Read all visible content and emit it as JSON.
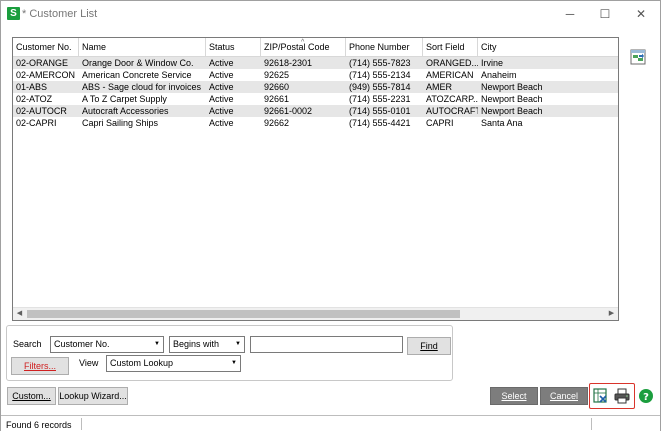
{
  "window": {
    "app_icon_letter": "S",
    "title": "* Customer List",
    "minimize_glyph": "─",
    "maximize_glyph": "☐",
    "close_glyph": "✕"
  },
  "grid": {
    "columns": [
      "Customer No.",
      "Name",
      "Status",
      "ZIP/Postal Code",
      "Phone Number",
      "Sort Field",
      "City"
    ],
    "sort_indicator": "^",
    "rows": [
      [
        "02-ORANGE",
        "Orange Door & Window Co.",
        "Active",
        "92618-2301",
        "(714) 555-7823",
        "ORANGED...",
        "Irvine"
      ],
      [
        "02-AMERCON",
        "American Concrete Service",
        "Active",
        "92625",
        "(714) 555-2134",
        "AMERICAN",
        "Anaheim"
      ],
      [
        "01-ABS",
        "ABS - Sage cloud for invoices",
        "Active",
        "92660",
        "(949) 555-7814",
        "AMER",
        "Newport Beach"
      ],
      [
        "02-ATOZ",
        "A To Z Carpet Supply",
        "Active",
        "92661",
        "(714) 555-2231",
        "ATOZCARP...",
        "Newport Beach"
      ],
      [
        "02-AUTOCR",
        "Autocraft Accessories",
        "Active",
        "92661-0002",
        "(714) 555-0101",
        "AUTOCRAFT",
        "Newport Beach"
      ],
      [
        "02-CAPRI",
        "Capri Sailing Ships",
        "Active",
        "92662",
        "(714) 555-4421",
        "CAPRI",
        "Santa Ana"
      ]
    ],
    "scroll_left": "◀",
    "scroll_right": "▶"
  },
  "search": {
    "search_label": "Search",
    "field_value": "Customer No.",
    "operator_value": "Begins with",
    "search_text": "",
    "find_label": "Find",
    "filters_label": "Filters...",
    "view_label": "View",
    "view_value": "Custom Lookup",
    "dropdown_glyph": "▼"
  },
  "footer": {
    "custom_label": "Custom...",
    "lookup_wizard_label": "Lookup Wizard...",
    "select_label": "Select",
    "cancel_label": "Cancel",
    "help_glyph": "?"
  },
  "status": {
    "text": "Found 6 records"
  },
  "colors": {
    "accent_green": "#1b9e3e",
    "highlight_red": "#d9342b",
    "row_alt": "#e6e6e6"
  },
  "icons": [
    "export-excel-icon",
    "print-icon",
    "help-icon",
    "column-settings-icon"
  ]
}
